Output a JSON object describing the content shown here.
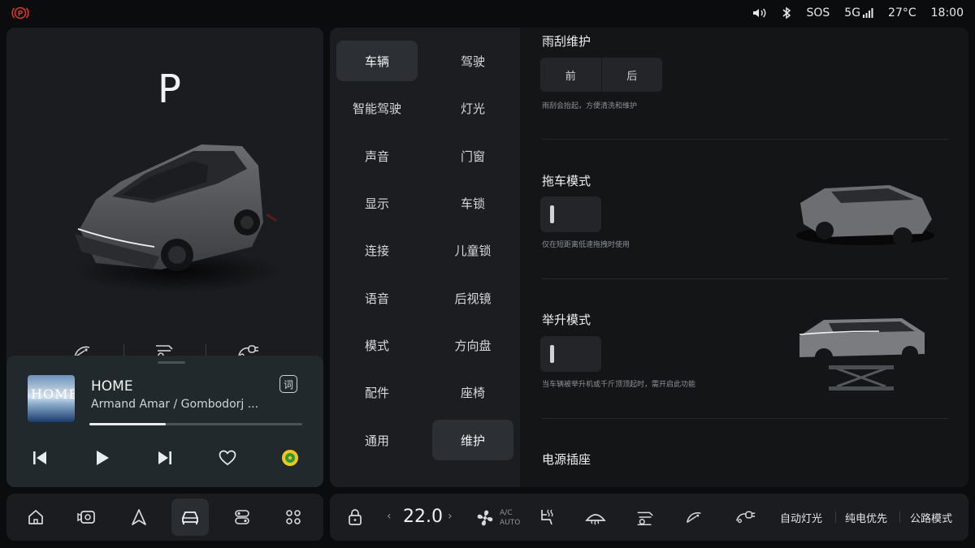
{
  "status_bar": {
    "volume_icon": "volume-icon",
    "bluetooth_icon": "bluetooth-icon",
    "sos": "SOS",
    "network": "5G",
    "temperature": "27°C",
    "time": "18:00",
    "alert_color": "#d8362b"
  },
  "vehicle": {
    "gear": "P",
    "quick_actions": [
      "wiper-icon",
      "trailer-icon",
      "charge-port-icon"
    ]
  },
  "media": {
    "album_title": "HOME",
    "song_title": "HOME",
    "artist": "Armand Amar / Gombodorj ...",
    "lyrics_button": "词",
    "progress": 0.36
  },
  "dock_left": {
    "items": [
      "home-icon",
      "camera-icon",
      "navigation-icon",
      "car-icon",
      "toggle-icon",
      "apps-icon"
    ],
    "selected": 3
  },
  "settings_nav": {
    "items": [
      {
        "label": "车辆"
      },
      {
        "label": "驾驶"
      },
      {
        "label": "智能驾驶"
      },
      {
        "label": "灯光"
      },
      {
        "label": "声音"
      },
      {
        "label": "门窗"
      },
      {
        "label": "显示"
      },
      {
        "label": "车锁"
      },
      {
        "label": "连接"
      },
      {
        "label": "儿童锁"
      },
      {
        "label": "语音"
      },
      {
        "label": "后视镜"
      },
      {
        "label": "模式"
      },
      {
        "label": "方向盘"
      },
      {
        "label": "配件"
      },
      {
        "label": "座椅"
      },
      {
        "label": "通用"
      },
      {
        "label": "维护"
      }
    ],
    "selected_left": "车辆",
    "selected_right": "维护"
  },
  "maintenance": {
    "wiper": {
      "title": "雨刮维护",
      "options": [
        "前",
        "后"
      ],
      "hint": "雨刮会抬起，方便清洗和维护"
    },
    "tow": {
      "title": "拖车模式",
      "hint": "仅在短距离低速拖拽时使用",
      "enabled": false
    },
    "lift": {
      "title": "举升模式",
      "hint": "当车辆被举升机或千斤顶顶起时，需开启此功能",
      "enabled": false
    },
    "power": {
      "title": "电源插座"
    }
  },
  "climate": {
    "temperature": "22.0",
    "ac_label": "A/C",
    "auto_label": "AUTO",
    "auto_light": "自动灯光",
    "ev_priority": "纯电优先",
    "road_mode": "公路模式"
  }
}
